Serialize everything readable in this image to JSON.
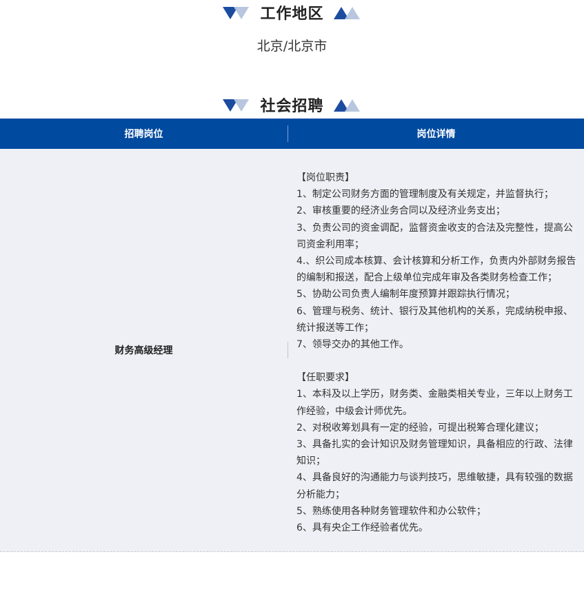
{
  "sections": {
    "region": {
      "title": "工作地区",
      "value": "北京/北京市"
    },
    "recruit": {
      "title": "社会招聘"
    }
  },
  "colors": {
    "header_bg": "#004aa0",
    "triangle_dark": "#1c4ca0",
    "triangle_light": "#b4c4dd",
    "row_bg": "#eef0f5"
  },
  "table": {
    "headers": [
      "招聘岗位",
      "岗位详情"
    ],
    "rows": [
      {
        "position": "财务高级经理",
        "details": [
          {
            "heading": "【岗位职责】",
            "lines": [
              "1、制定公司财务方面的管理制度及有关规定，并监督执行；",
              "2、审核重要的经济业务合同以及经济业务支出；",
              "3、负责公司的资金调配，监督资金收支的合法及完整性，提高公司资金利用率；",
              "4.、织公司成本核算、会计核算和分析工作，负责内外部财务报告的编制和报送，配合上级单位完成年审及各类财务检查工作；",
              "5、协助公司负责人编制年度预算并跟踪执行情况；",
              "6、管理与税务、统计、银行及其他机构的关系，完成纳税申报、统计报送等工作；",
              "7、领导交办的其他工作。"
            ]
          },
          {
            "heading": "【任职要求】",
            "lines": [
              "1、本科及以上学历，财务类、金融类相关专业，三年以上财务工作经验，中级会计师优先。",
              "2、对税收筹划具有一定的经验，可提出税筹合理化建议；",
              "3、具备扎实的会计知识及财务管理知识，具备相应的行政、法律知识；",
              "4、具备良好的沟通能力与谈判技巧，思维敏捷，具有较强的数据分析能力；",
              "5、熟练使用各种财务管理软件和办公软件；",
              "6、具有央企工作经验者优先。"
            ]
          }
        ]
      }
    ]
  }
}
